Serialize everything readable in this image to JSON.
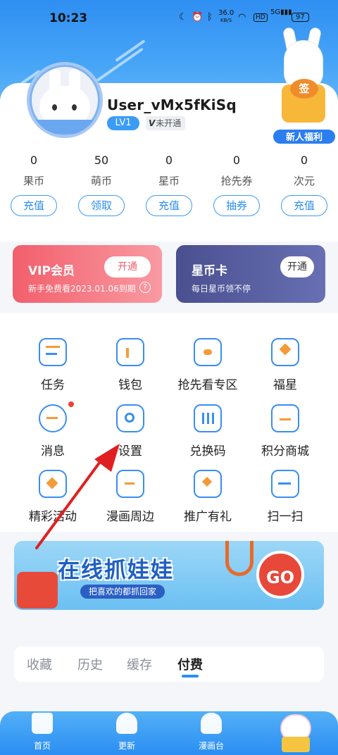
{
  "status_bar": {
    "time": "10:23",
    "network_speed_top": "36.0",
    "network_speed_unit": "KB/S",
    "hd": "HD",
    "net_type": "5G",
    "battery": "97"
  },
  "profile": {
    "username": "User_vMx5fKiSq",
    "level": "LV1",
    "vip_status_mark": "V",
    "vip_status": "未开通"
  },
  "welfare": {
    "sign_char": "签",
    "label": "新人福利"
  },
  "stats": [
    {
      "value": "0",
      "label": "果币",
      "button": "充值"
    },
    {
      "value": "50",
      "label": "萌币",
      "button": "领取"
    },
    {
      "value": "0",
      "label": "星币",
      "button": "充值"
    },
    {
      "value": "0",
      "label": "抢先券",
      "button": "抽券"
    },
    {
      "value": "0",
      "label": "次元",
      "button": "充值"
    }
  ],
  "vip_card": {
    "title": "VIP会员",
    "subtitle": "新手免费看2023.01.06到期",
    "button": "开通",
    "help": "?"
  },
  "star_card": {
    "title": "星币卡",
    "subtitle": "每日星币领不停",
    "button": "开通"
  },
  "grid": [
    {
      "label": "任务",
      "icon": "task-list-icon"
    },
    {
      "label": "钱包",
      "icon": "wallet-icon"
    },
    {
      "label": "抢先看专区",
      "icon": "ticket-icon"
    },
    {
      "label": "福星",
      "icon": "star-bag-icon"
    },
    {
      "label": "消息",
      "icon": "chat-bubble-icon"
    },
    {
      "label": "设置",
      "icon": "gear-icon"
    },
    {
      "label": "兑换码",
      "icon": "barcode-icon"
    },
    {
      "label": "积分商城",
      "icon": "gift-box-icon"
    },
    {
      "label": "精彩活动",
      "icon": "star-house-icon"
    },
    {
      "label": "漫画周边",
      "icon": "shopping-bag-icon"
    },
    {
      "label": "推广有礼",
      "icon": "heart-envelope-icon"
    },
    {
      "label": "扫一扫",
      "icon": "scan-icon"
    }
  ],
  "banner": {
    "title": "在线抓娃娃",
    "subtitle": "把喜欢的都抓回家",
    "go": "GO"
  },
  "tabs": [
    {
      "label": "收藏",
      "active": false
    },
    {
      "label": "历史",
      "active": false
    },
    {
      "label": "缓存",
      "active": false
    },
    {
      "label": "付费",
      "active": true
    }
  ],
  "bottom_nav": [
    {
      "label": "首页",
      "icon": "home-icon"
    },
    {
      "label": "更新",
      "icon": "update-icon"
    },
    {
      "label": "漫画台",
      "icon": "comic-desk-icon"
    }
  ],
  "colors": {
    "accent": "#2a8ef2",
    "vip": "#f25f6c",
    "star_card": "#4a4f8f",
    "annotation_arrow": "#e02020"
  }
}
